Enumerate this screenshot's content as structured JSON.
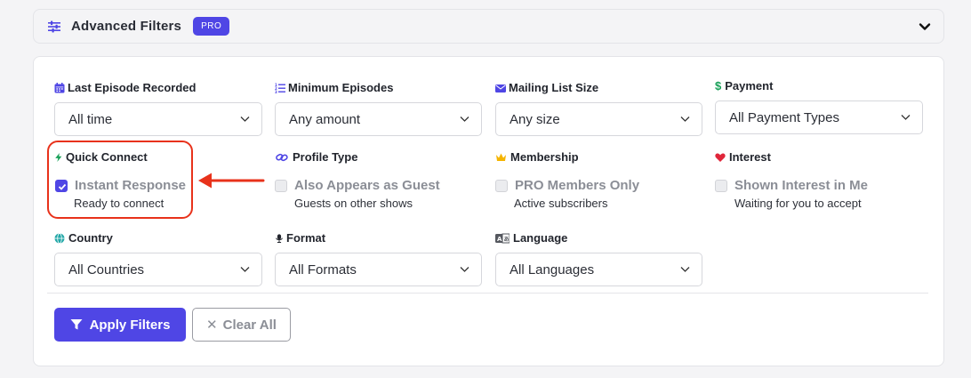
{
  "header": {
    "title": "Advanced Filters",
    "badge": "PRO"
  },
  "filters": {
    "last_episode": {
      "label": "Last Episode Recorded",
      "value": "All time",
      "icon": "calendar-icon"
    },
    "min_episodes": {
      "label": "Minimum Episodes",
      "value": "Any amount",
      "icon": "list-icon"
    },
    "mailing_list": {
      "label": "Mailing List Size",
      "value": "Any size",
      "icon": "envelope-icon"
    },
    "payment": {
      "label": "Payment",
      "value": "All Payment Types",
      "icon": "dollar-icon"
    },
    "quick_connect": {
      "label": "Quick Connect",
      "option": "Instant Response",
      "sub": "Ready to connect",
      "checked": true,
      "icon": "bolt-icon"
    },
    "profile_type": {
      "label": "Profile Type",
      "option": "Also Appears as Guest",
      "sub": "Guests on other shows",
      "checked": false,
      "icon": "link-icon"
    },
    "membership": {
      "label": "Membership",
      "option": "PRO Members Only",
      "sub": "Active subscribers",
      "checked": false,
      "icon": "crown-icon"
    },
    "interest": {
      "label": "Interest",
      "option": "Shown Interest in Me",
      "sub": "Waiting for you to accept",
      "checked": false,
      "icon": "heart-icon"
    },
    "country": {
      "label": "Country",
      "value": "All Countries",
      "icon": "globe-icon"
    },
    "format": {
      "label": "Format",
      "value": "All Formats",
      "icon": "microphone-icon"
    },
    "language": {
      "label": "Language",
      "value": "All Languages",
      "icon": "language-icon"
    }
  },
  "actions": {
    "apply": "Apply Filters",
    "clear": "Clear All"
  },
  "colors": {
    "accent": "#4f46e5",
    "highlight": "#e8321b",
    "green": "#18a058",
    "gold": "#f5b400",
    "red": "#e0263a"
  }
}
